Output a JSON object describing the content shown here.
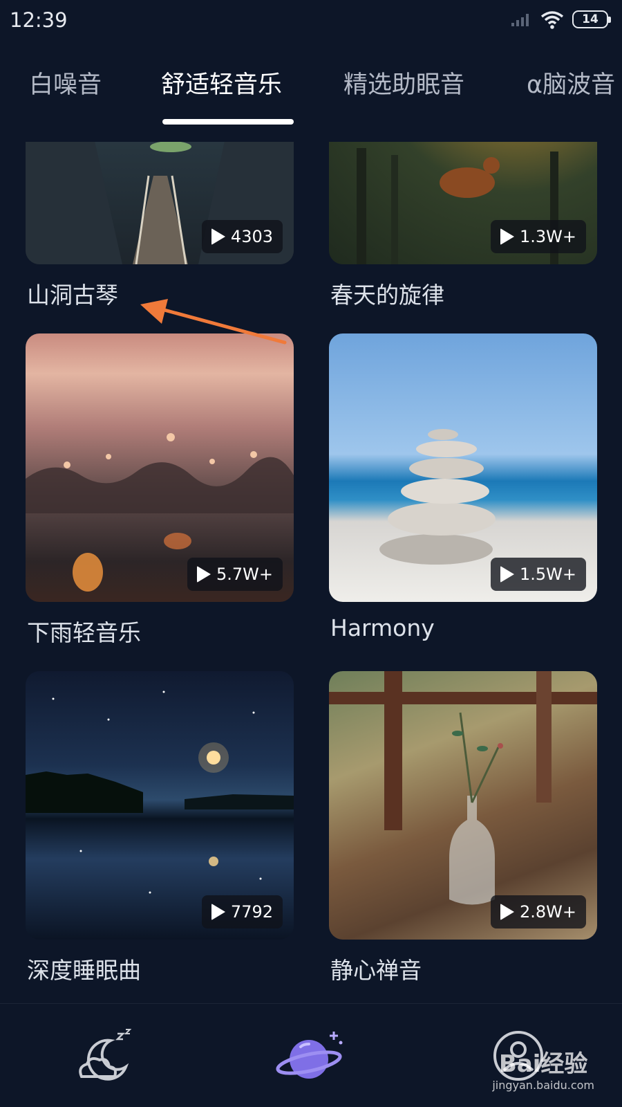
{
  "status_bar": {
    "time": "12:39",
    "battery_level": "14"
  },
  "tabs": [
    {
      "label": "白噪音",
      "active": false
    },
    {
      "label": "舒适轻音乐",
      "active": true
    },
    {
      "label": "精选助眠音",
      "active": false
    },
    {
      "label": "α脑波音",
      "active": false
    }
  ],
  "cards": [
    {
      "title": "山洞古琴",
      "plays": "4303"
    },
    {
      "title": "春天的旋律",
      "plays": "1.3W+"
    },
    {
      "title": "下雨轻音乐",
      "plays": "5.7W+"
    },
    {
      "title": "Harmony",
      "plays": "1.5W+"
    },
    {
      "title": "深度睡眠曲",
      "plays": "7792"
    },
    {
      "title": "静心禅音",
      "plays": "2.8W+"
    }
  ],
  "bottom_nav": [
    {
      "icon": "moon-sleep-icon"
    },
    {
      "icon": "planet-icon",
      "active": true
    },
    {
      "icon": "profile-icon"
    }
  ],
  "watermark": {
    "main": "Bai经验",
    "sub": "jingyan.baidu.com"
  },
  "colors": {
    "background": "#0d1628",
    "annotation_arrow": "#f07a3a",
    "planet": "#7f6fe6"
  }
}
